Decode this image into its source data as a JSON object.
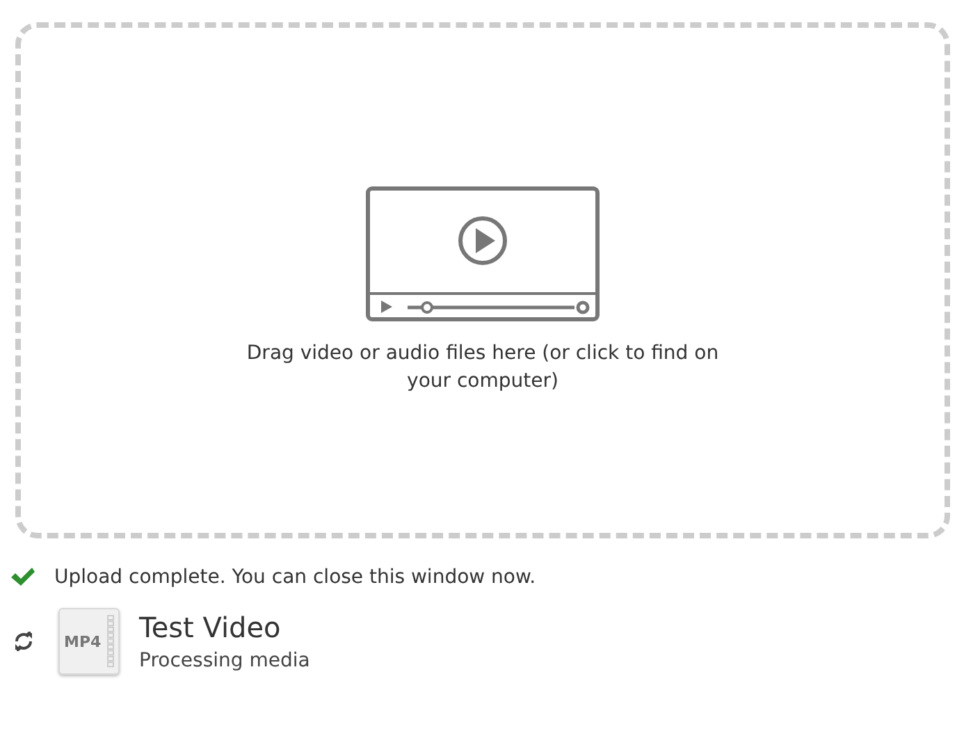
{
  "dropzone": {
    "prompt": "Drag video or audio files here (or click to find on your computer)"
  },
  "status": {
    "kind": "complete",
    "message": "Upload complete. You can close this window now."
  },
  "files": [
    {
      "kind": "processing",
      "format": "MP4",
      "name": "Test Video",
      "detail": "Processing media"
    }
  ]
}
